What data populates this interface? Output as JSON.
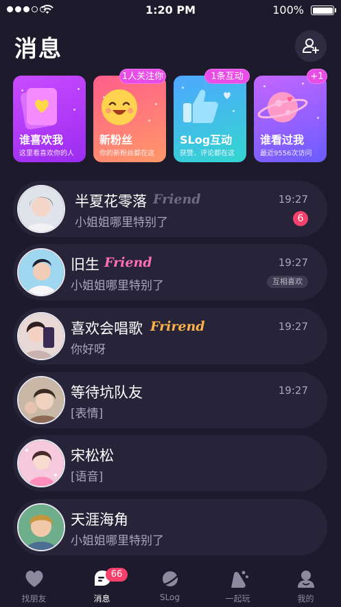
{
  "status_bar": {
    "time": "1:20 PM",
    "battery": "100%",
    "signal_icon": "signal-dots-icon",
    "wifi_icon": "wifi-icon",
    "battery_icon": "battery-icon"
  },
  "header": {
    "title": "消息",
    "add_friend_icon": "add-friend-icon"
  },
  "feature_cards": [
    {
      "title": "谁喜欢我",
      "subtitle": "这里看喜欢你的人",
      "badge": "",
      "icon": "heart-card-icon",
      "color": "#b03cf6"
    },
    {
      "title": "新粉丝",
      "subtitle": "你的新粉丝都在这",
      "badge": "1人关注你",
      "icon": "smiley-face-icon",
      "color": "#ff7479"
    },
    {
      "title": "SLog互动",
      "subtitle": "获赞、评论都在这",
      "badge": "1条互动",
      "icon": "thumbs-up-icon",
      "color": "#41bde6"
    },
    {
      "title": "谁看过我",
      "subtitle": "最近9556次访问",
      "badge": "+1",
      "icon": "planet-icon",
      "color": "#9460ff"
    }
  ],
  "conversations": [
    {
      "name": "半夏花零落",
      "tag": "Friend",
      "tag_color": "#6f6c82",
      "preview": "小姐姐哪里特别了",
      "time": "19:27",
      "unread": "6",
      "mutual": ""
    },
    {
      "name": "旧生",
      "tag": "Friend",
      "tag_color": "#ff6fb5",
      "preview": "小姐姐哪里特别了",
      "time": "19:27",
      "unread": "",
      "mutual": "互相喜欢"
    },
    {
      "name": "喜欢会唱歌",
      "tag": "Frirend",
      "tag_color": "#ffb347",
      "preview": "你好呀",
      "time": "19:27",
      "unread": "",
      "mutual": ""
    },
    {
      "name": "等待坑队友",
      "tag": "",
      "preview": "[表情]",
      "time": "19:27",
      "unread": "",
      "mutual": ""
    },
    {
      "name": "宋松松",
      "tag": "",
      "preview": "[语音]",
      "time": "",
      "unread": "",
      "mutual": ""
    },
    {
      "name": "天涯海角",
      "tag": "",
      "preview": "小姐姐哪里特别了",
      "time": "",
      "unread": "",
      "mutual": ""
    }
  ],
  "tabbar": {
    "tabs": [
      {
        "label": "找朋友",
        "icon": "heart-icon",
        "active": false
      },
      {
        "label": "消息",
        "icon": "message-icon",
        "active": true,
        "badge": "66"
      },
      {
        "label": "SLog",
        "icon": "planet-tab-icon",
        "active": false
      },
      {
        "label": "一起玩",
        "icon": "play-together-icon",
        "active": false
      },
      {
        "label": "我的",
        "icon": "profile-icon",
        "active": false
      }
    ]
  },
  "colors": {
    "background": "#1c1a2b",
    "row_background": "#27243a",
    "badge": "#f5416b"
  }
}
